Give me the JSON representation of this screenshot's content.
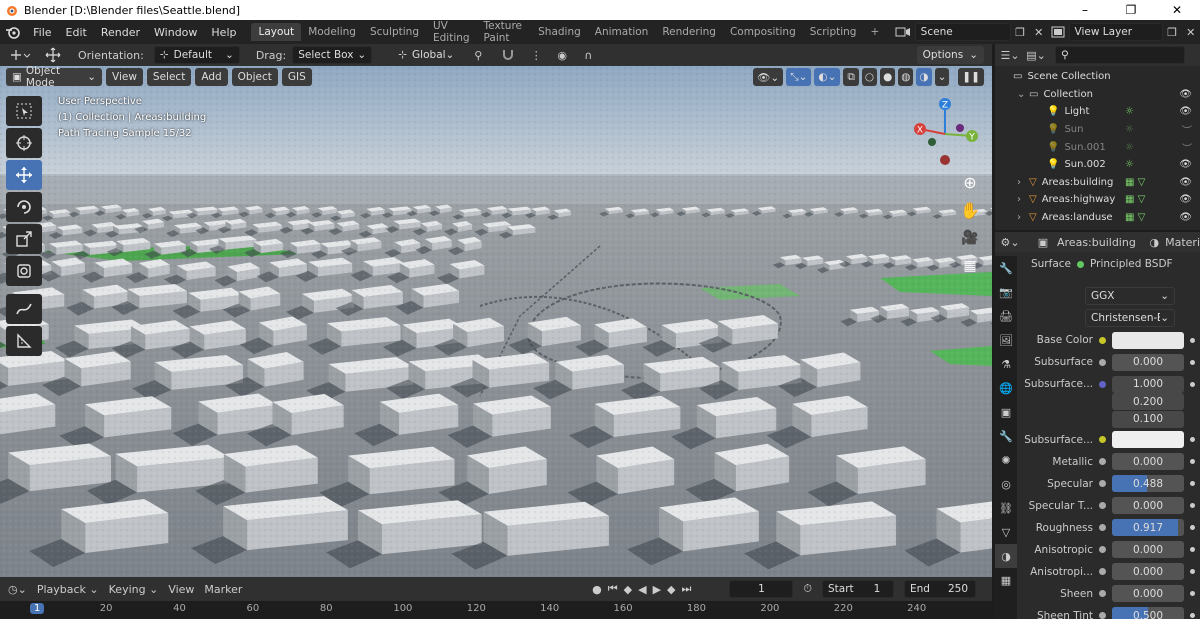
{
  "window": {
    "title": "Blender [D:\\Blender files\\Seattle.blend]",
    "minimize": "–",
    "maximize": "❐",
    "close": "✕"
  },
  "menu": [
    "File",
    "Edit",
    "Render",
    "Window",
    "Help"
  ],
  "workspaces": [
    "Layout",
    "Modeling",
    "Sculpting",
    "UV Editing",
    "Texture Paint",
    "Shading",
    "Animation",
    "Rendering",
    "Compositing",
    "Scripting"
  ],
  "add_workspace": "+",
  "scene": {
    "name": "Scene",
    "view_layer": "View Layer"
  },
  "toolbar": {
    "orientation_label": "Orientation:",
    "orientation_value": "Default",
    "drag_label": "Drag:",
    "drag_value": "Select Box",
    "transform_space": "Global",
    "options": "Options"
  },
  "viewport_header": {
    "mode": "Object Mode",
    "menus": [
      "View",
      "Select",
      "Add",
      "Object",
      "GIS"
    ]
  },
  "overlay": {
    "line1": "User Perspective",
    "line2": "(1) Collection | Areas:building",
    "line3": "Path Tracing Sample 15/32"
  },
  "gizmo": {
    "x": "X",
    "y": "Y",
    "z": "Z"
  },
  "timeline": {
    "playback": "Playback",
    "keying": "Keying",
    "view": "View",
    "marker": "Marker",
    "current_frame": "1",
    "start_label": "Start",
    "start_value": "1",
    "end_label": "End",
    "end_value": "250",
    "ruler": [
      "1",
      "20",
      "40",
      "60",
      "80",
      "100",
      "120",
      "140",
      "160",
      "180",
      "200",
      "220",
      "240"
    ]
  },
  "outliner": {
    "root": "Scene Collection",
    "rows": [
      {
        "name": "Collection",
        "type": "collection",
        "level": 1,
        "dim": false
      },
      {
        "name": "Light",
        "type": "light",
        "level": 2,
        "dim": false
      },
      {
        "name": "Sun",
        "type": "light",
        "level": 2,
        "dim": true
      },
      {
        "name": "Sun.001",
        "type": "light",
        "level": 2,
        "dim": true
      },
      {
        "name": "Sun.002",
        "type": "light",
        "level": 2,
        "dim": false
      },
      {
        "name": "Areas:building",
        "type": "mesh",
        "level": 1,
        "dim": false
      },
      {
        "name": "Areas:highway",
        "type": "mesh",
        "level": 1,
        "dim": false
      },
      {
        "name": "Areas:landuse",
        "type": "mesh",
        "level": 1,
        "dim": false
      }
    ]
  },
  "properties": {
    "object": "Areas:building",
    "material_tab": "Materi",
    "surface_label": "Surface",
    "surface_value": "Principled BSDF",
    "distribution": "GGX",
    "subsurface_method": "Christensen-Bur...",
    "rows": [
      {
        "label": "Base Color",
        "type": "color",
        "value": "",
        "fill": 0,
        "color": "#e8e8e8"
      },
      {
        "label": "Subsurface",
        "type": "num",
        "value": "0.000",
        "fill": 0
      },
      {
        "label": "Subsurface...",
        "type": "vec",
        "value": "1.000",
        "fill": 0
      },
      {
        "label": "",
        "type": "vec2",
        "value": "0.200",
        "fill": 0
      },
      {
        "label": "",
        "type": "vec2",
        "value": "0.100",
        "fill": 0
      },
      {
        "label": "Subsurface...",
        "type": "color",
        "value": "",
        "fill": 0,
        "color": "#efefef"
      },
      {
        "label": "Metallic",
        "type": "num",
        "value": "0.000",
        "fill": 0
      },
      {
        "label": "Specular",
        "type": "num",
        "value": "0.488",
        "fill": 0.488
      },
      {
        "label": "Specular T...",
        "type": "num",
        "value": "0.000",
        "fill": 0
      },
      {
        "label": "Roughness",
        "type": "num",
        "value": "0.917",
        "fill": 0.917
      },
      {
        "label": "Anisotropic",
        "type": "num",
        "value": "0.000",
        "fill": 0
      },
      {
        "label": "Anisotropi...",
        "type": "num",
        "value": "0.000",
        "fill": 0
      },
      {
        "label": "Sheen",
        "type": "num",
        "value": "0.000",
        "fill": 0
      },
      {
        "label": "Sheen Tint",
        "type": "num",
        "value": "0.500",
        "fill": 0.5
      }
    ]
  },
  "colors": {
    "accent": "#4772b3",
    "green": "#7bd16a",
    "orange": "#e89a3c"
  }
}
